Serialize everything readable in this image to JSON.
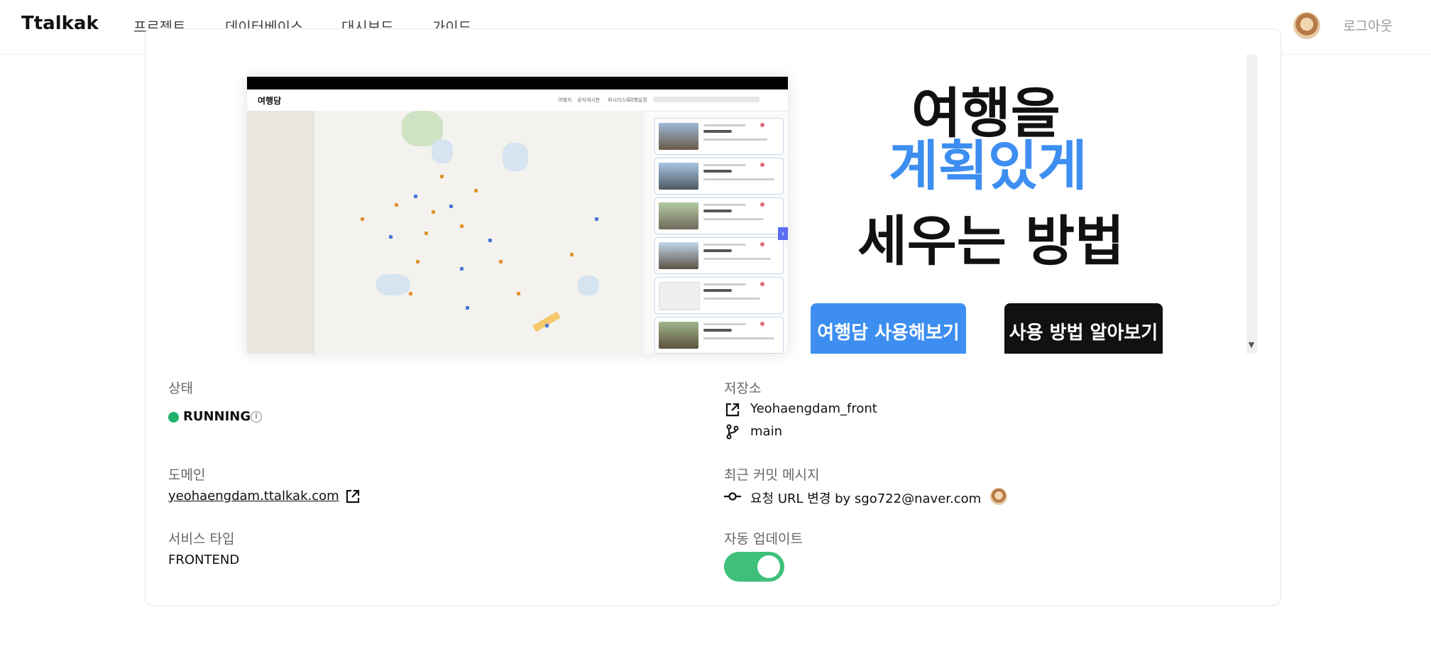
{
  "nav": {
    "brand": "Ttalkak",
    "links": [
      "프로젝트",
      "데이터베이스",
      "대시보드",
      "가이드"
    ],
    "logout": "로그아웃"
  },
  "preview": {
    "app_logo": "여행담",
    "menu": [
      "여행지",
      "공지게시판",
      "위시리스트",
      "여행일정"
    ],
    "hero_line1": "여행을",
    "hero_line2": "계획있게",
    "hero_line3": "세우는 방법",
    "btn_primary": "여행담 사용해보기",
    "btn_secondary": "사용 방법 알아보기"
  },
  "details": {
    "status_label": "상태",
    "status_value": "RUNNING",
    "status_color": "#1fb36b",
    "repo_label": "저장소",
    "repo_name": "Yeohaengdam_front",
    "branch": "main",
    "domain_label": "도메인",
    "domain_value": "yeohaengdam.ttalkak.com",
    "commit_label": "최근 커밋 메시지",
    "commit_message": "요청 URL 변경 by sgo722@naver.com",
    "service_label": "서비스 타입",
    "service_value": "FRONTEND",
    "auto_update_label": "자동 업데이트",
    "auto_update_on": true,
    "accent": "#3d8ef0",
    "toggle_color": "#3ec07b"
  }
}
